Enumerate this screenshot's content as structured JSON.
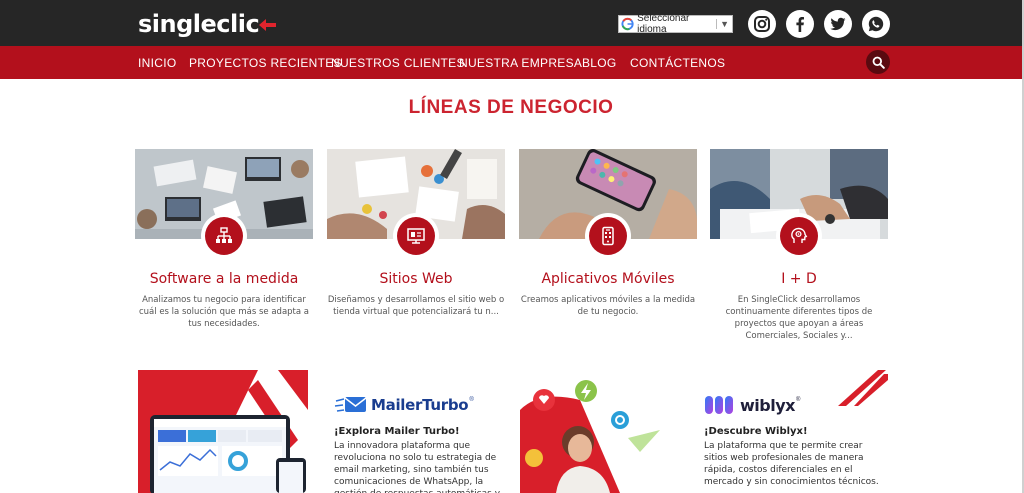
{
  "brand": {
    "logo_text": "singleclic",
    "accent": "#e0242d"
  },
  "header": {
    "language_selector": {
      "label": "Seleccionar idioma"
    },
    "social_icons": [
      "instagram-icon",
      "facebook-icon",
      "twitter-icon",
      "whatsapp-icon"
    ]
  },
  "nav": {
    "items": [
      {
        "label": "INICIO"
      },
      {
        "label": "PROYECTOS RECIENTES"
      },
      {
        "label": "NUESTROS CLIENTES"
      },
      {
        "label": "NUESTRA EMPRESA"
      },
      {
        "label": "BLOG"
      },
      {
        "label": "CONTÁCTENOS"
      }
    ],
    "search_icon": "search-icon"
  },
  "section": {
    "title": "LÍNEAS DE NEGOCIO",
    "cards": [
      {
        "title": "Software a la medida",
        "desc": "Analizamos tu negocio para identificar cuál es la solución que más se adapta a tus necesidades.",
        "icon": "network-icon"
      },
      {
        "title": "Sitios Web",
        "desc": "Diseñamos y desarrollamos el sitio web o tienda virtual que potencializará tu n...",
        "icon": "monitor-icon"
      },
      {
        "title": "Aplicativos Móviles",
        "desc": "Creamos aplicativos móviles a la medida de tu negocio.",
        "icon": "mobile-icon"
      },
      {
        "title": "I + D",
        "desc": "En SingleClick desarrollamos continuamente diferentes tipos de proyectos que apoyan a áreas Comerciales, Sociales y...",
        "icon": "head-gears-icon"
      }
    ]
  },
  "promos": [
    {
      "logo_text": "MailerTurbo",
      "heading": "¡Explora Mailer Turbo!",
      "body": "La innovadora plataforma que revoluciona no solo tu estrategia de email marketing, sino también tus comunicaciones de WhatsApp, la gestión de respuestas automáticas y"
    },
    {
      "logo_text": "wiblyx",
      "heading": "¡Descubre Wiblyx!",
      "body": "La plataforma que te permite crear sitios web profesionales de manera rápida, costos diferenciales en el mercado y sin conocimientos técnicos."
    }
  ]
}
